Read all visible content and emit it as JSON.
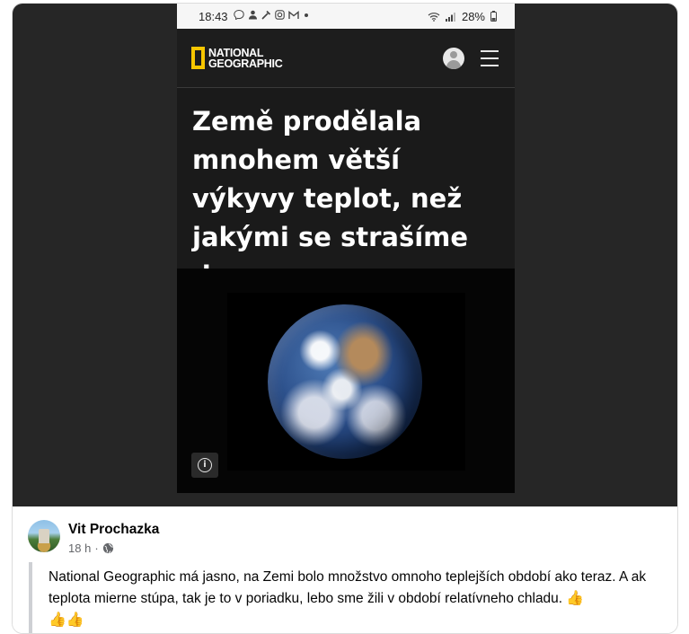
{
  "status_bar": {
    "time": "18:43",
    "notification_icons": [
      "messenger-icon",
      "person-icon",
      "tool-icon",
      "instagram-icon",
      "gmail-icon",
      "dot-icon"
    ],
    "battery": "28%"
  },
  "natgeo": {
    "logo_line1": "NATIONAL",
    "logo_line2": "GEOGRAPHIC",
    "brand_color": "#f7c600"
  },
  "article": {
    "headline": "Země prodělala mnohem větší výkyvy teplot, než jakými se strašíme dnes",
    "info_icon": "i"
  },
  "post": {
    "author": "Vit Prochazka",
    "time": "18 h",
    "separator": "·",
    "text": "National Geographic má jasno, na Zemi bolo množstvo omnoho teplejších období ako teraz. A ak teplota mierne stúpa, tak je to v poriadku, lebo sme žili v období relatívneho chladu.",
    "emoji_line": "👍👍",
    "emoji_inline": "👍"
  }
}
